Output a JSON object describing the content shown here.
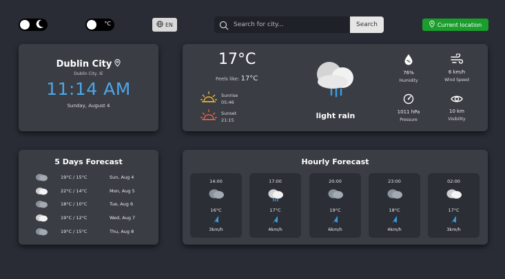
{
  "header": {
    "temp_unit_symbol": "°C",
    "language": "EN",
    "search": {
      "placeholder": "Search for city...",
      "button_label": "Search"
    },
    "current_location_label": "Current location"
  },
  "city": {
    "name": "Dublin City",
    "subtitle": "Dublin City, IE",
    "time": "11:14 AM",
    "date": "Sunday, August 4"
  },
  "current": {
    "temp": "17°C",
    "feels_label": "Feels like:",
    "feels_value": "17°C",
    "sunrise_label": "Sunrise",
    "sunrise_time": "05:46",
    "sunset_label": "Sunset",
    "sunset_time": "21:15",
    "condition": "light rain",
    "stats": [
      {
        "icon": "humidity-icon",
        "value": "76%",
        "label": "Humidity"
      },
      {
        "icon": "wind-icon",
        "value": "6 km/h",
        "label": "Wind Speed"
      },
      {
        "icon": "pressure-icon",
        "value": "1011 hPa",
        "label": "Pressure"
      },
      {
        "icon": "visibility-icon",
        "value": "10 km",
        "label": "Visibility"
      }
    ]
  },
  "forecast": {
    "title": "5 Days Forecast",
    "days": [
      {
        "icon": "dark-cloud-icon",
        "temp": "19°C / 15°C",
        "date": "Sun, Aug 4"
      },
      {
        "icon": "light-cloud-icon",
        "temp": "22°C / 14°C",
        "date": "Mon, Aug 5"
      },
      {
        "icon": "dark-cloud-icon",
        "temp": "18°C / 10°C",
        "date": "Tue, Aug 6"
      },
      {
        "icon": "light-cloud-icon",
        "temp": "19°C / 12°C",
        "date": "Wed, Aug 7"
      },
      {
        "icon": "dark-cloud-icon",
        "temp": "19°C / 15°C",
        "date": "Thu, Aug 8"
      }
    ]
  },
  "hourly": {
    "title": "Hourly Forecast",
    "items": [
      {
        "time": "14:00",
        "icon": "dark-cloud-icon",
        "temp": "16°C",
        "wind": "3km/h"
      },
      {
        "time": "17:00",
        "icon": "rain-cloud-icon",
        "temp": "17°C",
        "wind": "4km/h"
      },
      {
        "time": "20:00",
        "icon": "dark-cloud-icon",
        "temp": "19°C",
        "wind": "6km/h"
      },
      {
        "time": "23:00",
        "icon": "dark-cloud-icon",
        "temp": "18°C",
        "wind": "4km/h"
      },
      {
        "time": "02:00",
        "icon": "light-cloud-icon",
        "temp": "17°C",
        "wind": "3km/h"
      }
    ]
  },
  "colors": {
    "background": "#292c35",
    "card": "#3a3d44",
    "time_blue": "#4ea6e8",
    "location_green": "#1a9e2c",
    "wind_blue": "#3a9be0"
  }
}
